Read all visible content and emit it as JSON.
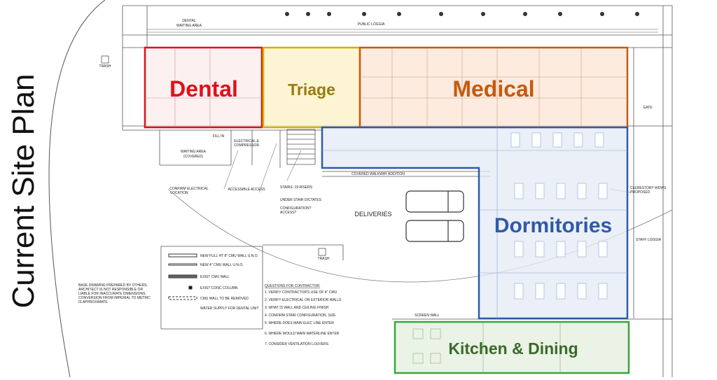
{
  "title": "Current Site Plan",
  "zones": {
    "dental": {
      "label": "Dental",
      "color": "#e0101a"
    },
    "triage": {
      "label": "Triage",
      "color": "#9a7a10"
    },
    "medical": {
      "label": "Medical",
      "color": "#c55a11"
    },
    "dormitories": {
      "label": "Dormitories",
      "color": "#2f5aa8"
    },
    "kitchen": {
      "label": "Kitchen & Dining",
      "color": "#3a7a2a"
    }
  },
  "plan_labels": {
    "public_loggia": "PUBLIC LOGGIA",
    "dental_waiting": "DENTAL",
    "dental_waiting2": "WAITING AREA",
    "trash_top": "TRASH",
    "trash_mid": "TRASH",
    "deliveries": "DELIVERIES",
    "covered_walkway": "COVERED WALKWAY ADDITION",
    "waiting_covered": "WAITING AREA",
    "waiting_covered2": "(COVERED)",
    "electrical": "ELECTRICAL &",
    "electrical2": "COMPRESSOR",
    "fill_in": "FILL IN",
    "confirm_electrical": "CONFIRM ELECTRICAL",
    "confirm_electrical2": "LOCATION",
    "accessible_access": "ACCESSIBLE ACCESS",
    "stairs": "STAIRS: 19 RISERS",
    "stairs2": "UNDER STAIR DICTATES",
    "stairs3": "CONFIGURATION?",
    "stairs4": "ACCESS?",
    "clerestory": "CLERESTORY WDWS",
    "clerestory2": "PROPOSED",
    "staff_loggia": "STAFF LOGGIA",
    "screen_wall": "SCREEN WALL",
    "gate": "GATE"
  },
  "legend": {
    "items": [
      "NEW FULL HT 8\" CMU WALL U.N.O.",
      "NEW 4\" CMU WALL U.N.O.",
      "EXIST CMU WALL",
      "EXIST CONC COLUMN",
      "CMU WALL TO BE REMOVED",
      "WATER SUPPLY FOR DENTAL UNIT"
    ]
  },
  "notes": {
    "base": [
      "BASE DRAWING PREPARED BY OTHERS.",
      "ARCHITECT IS NOT RESPONSIBLE OR",
      "LIABLE FOR INACCURATE DIMENSIONS.",
      "CONVERSION FROM IMPERIAL TO METRIC",
      "IS APPROXIMATE"
    ],
    "questions_title": "QUESTIONS FOR CONTRACTOR:",
    "questions": [
      "1.  VERIFY CONTRACTOR'S USE OF 4\" CMU",
      "2.  VERIFY ELECTRICAL ON EXTERIOR WALLS",
      "3.  WHAT IS WALL AND CEILING FINISH",
      "4.  CONFIRM STAIR CONFIGURATION, SIZE",
      "5.  WHERE DOES MAIN ELEC LINE ENTER",
      "6.  WHERE WOULD MAIN WATERLINE ENTER",
      "7.  CONSIDER VENTILATION LOUVERS"
    ]
  }
}
